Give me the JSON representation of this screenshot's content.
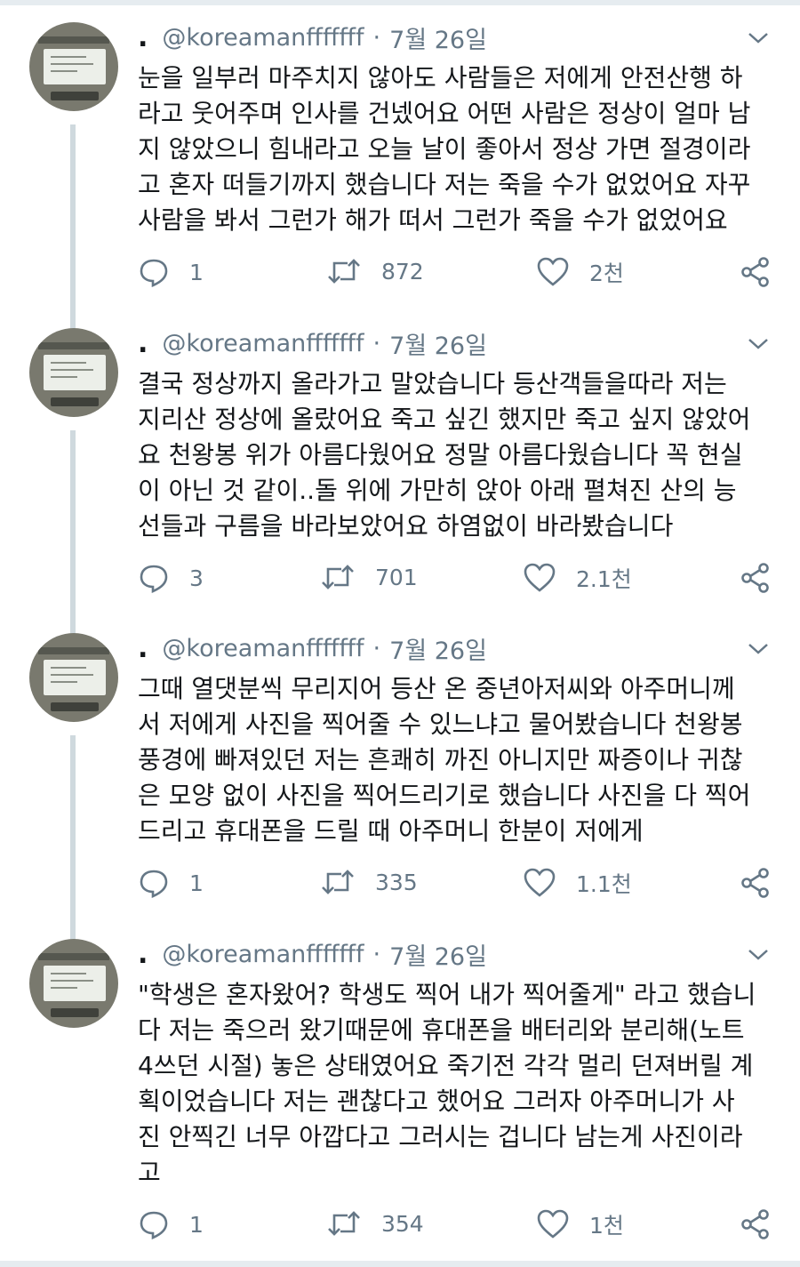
{
  "tweets": [
    {
      "handle": "@koreamanfffffff",
      "date": "7월 26일",
      "lines": [
        "눈을 일부러 마주치지 않아도 사람들은 저에게 안전산행 하",
        "라고 웃어주며 인사를 건넸어요 어떤 사람은 정상이 얼마 남",
        "지 않았으니 힘내라고 오늘 날이 좋아서 정상 가면 절경이라",
        "고 혼자 떠들기까지 했습니다 저는 죽을 수가 없었어요 자꾸",
        "사람을 봐서 그런가 해가 떠서 그런가 죽을 수가 없었어요"
      ],
      "replies": "1",
      "retweets": "872",
      "likes": "2천"
    },
    {
      "handle": "@koreamanfffffff",
      "date": "7월 26일",
      "lines": [
        "결국 정상까지 올라가고 말았습니다 등산객들을따라 저는",
        "지리산 정상에 올랐어요 죽고 싶긴 했지만 죽고 싶지 않았어",
        "요 천왕봉 위가 아름다웠어요 정말 아름다웠습니다 꼭 현실",
        "이 아닌 것 같이..돌 위에 가만히 앉아 아래 펼쳐진 산의 능",
        "선들과 구름을 바라보았어요 하염없이 바라봤습니다"
      ],
      "replies": "3",
      "retweets": "701",
      "likes": "2.1천"
    },
    {
      "handle": "@koreamanfffffff",
      "date": "7월 26일",
      "lines": [
        "그때 열댓분씩 무리지어 등산 온 중년아저씨와 아주머니께",
        "서 저에게 사진을 찍어줄 수 있느냐고 물어봤습니다 천왕봉",
        "풍경에 빠져있던 저는 흔쾌히 까진 아니지만 짜증이나 귀찮",
        "은 모양 없이 사진을 찍어드리기로 했습니다 사진을 다 찍어",
        "드리고 휴대폰을 드릴 때 아주머니 한분이 저에게"
      ],
      "replies": "1",
      "retweets": "335",
      "likes": "1.1천"
    },
    {
      "handle": "@koreamanfffffff",
      "date": "7월 26일",
      "lines": [
        "\"학생은 혼자왔어? 학생도 찍어 내가 찍어줄게\" 라고 했습니",
        "다 저는 죽으러 왔기때문에 휴대폰을 배터리와 분리해(노트",
        "4쓰던 시절) 놓은 상태였어요 죽기전 각각 멀리 던져버릴 계",
        "획이었습니다 저는 괜찮다고 했어요 그러자 아주머니가 사",
        "진 안찍긴 너무 아깝다고 그러시는 겁니다 남는게 사진이라",
        "고"
      ],
      "replies": "1",
      "retweets": "354",
      "likes": "1천"
    }
  ],
  "icons": {
    "reply": "speech-bubble-icon",
    "retweet": "retweet-icon",
    "like": "heart-icon",
    "share": "share-icon",
    "menu": "chevron-down-icon"
  },
  "colors": {
    "text": "#14171a",
    "muted": "#657786",
    "thread": "#cfd9de"
  }
}
